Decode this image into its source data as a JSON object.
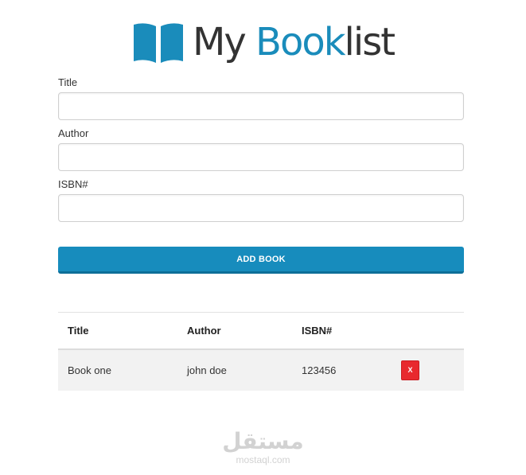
{
  "header": {
    "title_prefix": "My ",
    "title_accent": "Book",
    "title_suffix": "list",
    "icon": "open-book-icon",
    "accent_color": "#1a8cbb"
  },
  "form": {
    "title_label": "Title",
    "title_value": "",
    "author_label": "Author",
    "author_value": "",
    "isbn_label": "ISBN#",
    "isbn_value": "",
    "submit_label": "Add Book",
    "submit_color": "#178cbd"
  },
  "table": {
    "headers": [
      "Title",
      "Author",
      "ISBN#"
    ],
    "rows": [
      {
        "title": "Book one",
        "author": "john doe",
        "isbn": "123456",
        "delete_label": "X"
      }
    ],
    "delete_color": "#e8292e"
  },
  "watermark": {
    "arabic": "مستقل",
    "latin": "mostaql.com"
  }
}
